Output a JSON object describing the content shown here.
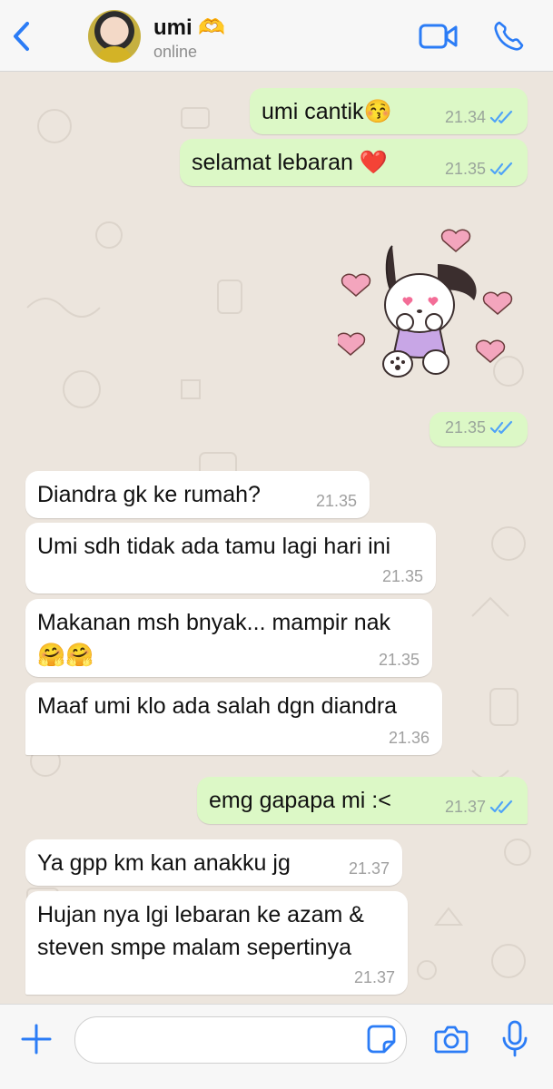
{
  "header": {
    "contact_name": "umi 🫶",
    "status": "online"
  },
  "messages": [
    {
      "dir": "out",
      "text": "umi cantik😚",
      "time": "21.34",
      "ticks": "read"
    },
    {
      "dir": "out",
      "text": "selamat lebaran ❤️",
      "time": "21.35",
      "ticks": "read"
    },
    {
      "dir": "out",
      "kind": "sticker",
      "time": "21.35",
      "ticks": "read"
    },
    {
      "dir": "in",
      "text": "Diandra gk ke rumah?",
      "time": "21.35"
    },
    {
      "dir": "in",
      "text": "Umi sdh tidak ada tamu lagi hari ini",
      "time": "21.35"
    },
    {
      "dir": "in",
      "text": "Makanan msh bnyak... mampir nak",
      "text2": "🤗🤗",
      "time": "21.35"
    },
    {
      "dir": "in",
      "text": "Maaf umi klo ada salah dgn diandra",
      "time": "21.36"
    },
    {
      "dir": "out",
      "text": "emg gapapa mi :<",
      "time": "21.37",
      "ticks": "read"
    },
    {
      "dir": "in",
      "text": "Ya gpp km kan anakku jg",
      "time": "21.37"
    },
    {
      "dir": "in",
      "text": "Hujan nya lgi lebaran ke azam &",
      "text2": "steven smpe malam sepertinya",
      "time": "21.37"
    }
  ],
  "colors": {
    "outgoing_bubble": "#dcf8c6",
    "incoming_bubble": "#ffffff",
    "accent_blue": "#2b7cf6",
    "chat_background": "#ece5dd"
  },
  "icons": [
    "back-chevron-icon",
    "video-call-icon",
    "phone-call-icon",
    "plus-icon",
    "sticker-icon",
    "camera-icon",
    "mic-icon",
    "double-check-icon"
  ]
}
